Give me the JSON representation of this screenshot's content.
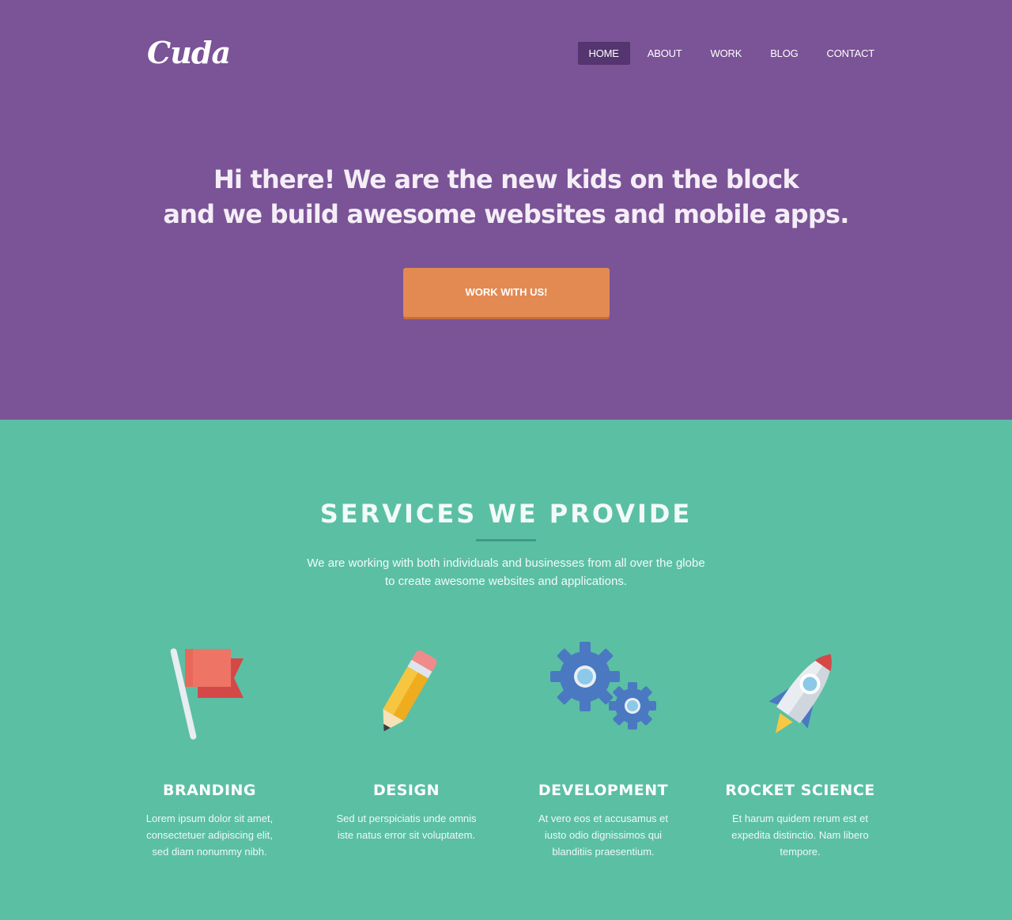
{
  "brand": {
    "logo_text": "Cuda",
    "colors": {
      "hero_bg": "#7b5397",
      "nav_active_bg": "#54356f",
      "cta_bg": "#e38a52",
      "services_bg": "#5bbfa4"
    }
  },
  "nav": {
    "items": [
      {
        "label": "HOME",
        "active": true
      },
      {
        "label": "ABOUT",
        "active": false
      },
      {
        "label": "WORK",
        "active": false
      },
      {
        "label": "BLOG",
        "active": false
      },
      {
        "label": "CONTACT",
        "active": false
      }
    ]
  },
  "hero": {
    "headline_line1": "Hi there! We are the new kids on the block",
    "headline_line2": "and we build awesome websites and mobile apps.",
    "cta_label": "WORK WITH US!"
  },
  "services": {
    "title": "SERVICES WE PROVIDE",
    "intro_line1": "We are working with both individuals and businesses from all over the globe",
    "intro_line2": "to create awesome websites and applications.",
    "items": [
      {
        "icon": "flag-icon",
        "title": "BRANDING",
        "text": "Lorem ipsum dolor sit amet, consectetuer adipiscing elit, sed diam nonummy nibh."
      },
      {
        "icon": "pencil-icon",
        "title": "DESIGN",
        "text": "Sed ut perspiciatis unde omnis iste natus error sit voluptatem."
      },
      {
        "icon": "gears-icon",
        "title": "DEVELOPMENT",
        "text": "At vero eos et accusamus et iusto odio dignissimos qui blanditiis praesentium."
      },
      {
        "icon": "rocket-icon",
        "title": "ROCKET SCIENCE",
        "text": "Et harum quidem rerum est et expedita distinctio. Nam libero tempore."
      }
    ]
  }
}
